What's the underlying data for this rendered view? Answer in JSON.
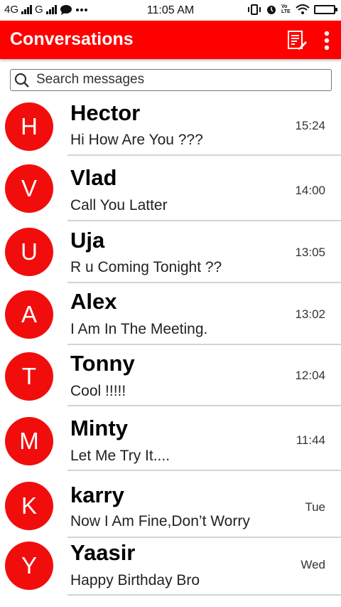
{
  "status_bar": {
    "network_left": "4G",
    "network_right": "G",
    "time": "11:05 AM",
    "volte": "Vo LTE"
  },
  "app_bar": {
    "title": "Conversations",
    "compose_icon": "compose-icon",
    "more_icon": "more-vert-icon",
    "background": "#ff0000"
  },
  "search": {
    "placeholder": "Search messages"
  },
  "conversations": [
    {
      "initial": "H",
      "name": "Hector",
      "message": "Hi How Are You ???",
      "time": "15:24"
    },
    {
      "initial": "V",
      "name": "Vlad",
      "message": "Call You Latter",
      "time": "14:00"
    },
    {
      "initial": "U",
      "name": "Uja",
      "message": "R u Coming Tonight ??",
      "time": "13:05"
    },
    {
      "initial": "A",
      "name": "Alex",
      "message": "I Am In The Meeting.",
      "time": "13:02"
    },
    {
      "initial": "T",
      "name": "Tonny",
      "message": "Cool !!!!!",
      "time": "12:04"
    },
    {
      "initial": "M",
      "name": "Minty",
      "message": "Let Me Try It....",
      "time": "11:44"
    },
    {
      "initial": "K",
      "name": "karry",
      "message": "Now I Am Fine,Don’t Worry",
      "time": "Tue"
    },
    {
      "initial": "Y",
      "name": "Yaasir",
      "message": "Happy Birthday Bro",
      "time": "Wed"
    }
  ],
  "colors": {
    "avatar": "#f20d0d",
    "divider": "#d4d4d4"
  }
}
